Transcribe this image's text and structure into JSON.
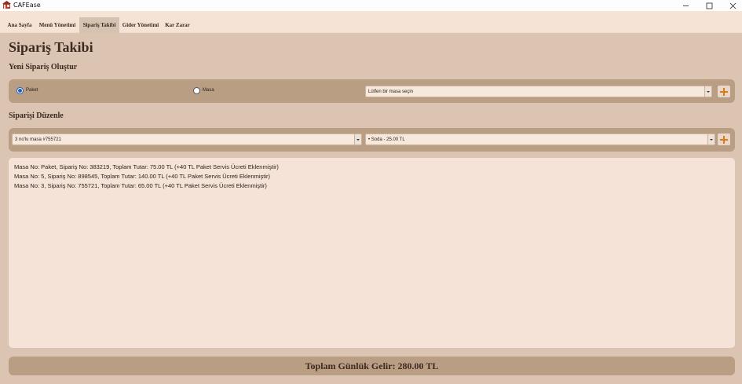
{
  "window": {
    "title": "CAFEase",
    "controls": [
      "minimize-icon",
      "maximize-icon",
      "close-icon"
    ]
  },
  "nav": {
    "tabs": [
      {
        "label": "Ana Sayfa",
        "active": false
      },
      {
        "label": "Menü Yönetimi",
        "active": false
      },
      {
        "label": "Sipariş Takibi",
        "active": true
      },
      {
        "label": "Gider Yönetimi",
        "active": false
      },
      {
        "label": "Kar Zarar",
        "active": false
      }
    ]
  },
  "page": {
    "title": "Sipariş Takibi",
    "new_order": {
      "section_title": "Yeni Sipariş Oluştur",
      "radio_paket": "Paket",
      "radio_masa": "Masa",
      "selected": "Paket",
      "table_select_value": "Lütfen bir masa seçin",
      "add_icon": "plus-icon"
    },
    "edit_order": {
      "section_title": "Siparişi Düzenle",
      "order_select_value": "3 no'lu masa #755721",
      "product_select_value": "• Soda - 25.00 TL",
      "add_icon": "plus-icon"
    },
    "orders": [
      "Masa No: Paket, Sipariş No: 383219, Toplam Tutar: 75.00 TL (+40 TL Paket Servis Ücreti Eklenmiştir)",
      "Masa No: 5, Sipariş No: 898545, Toplam Tutar: 140.00 TL (+40 TL Paket Servis Ücreti Eklenmiştir)",
      "Masa No: 3, Sipariş No: 755721, Toplam Tutar: 65.00 TL (+40 TL Paket Servis Ücreti Eklenmiştir)"
    ],
    "total_label": "Toplam Günlük Gelir: 280.00 TL"
  },
  "colors": {
    "background": "#f5e3d5",
    "panel": "#dbc5b2",
    "bar": "#b99e83",
    "accent_orange": "#d97a17",
    "text_dark": "#3d2a21",
    "radio_blue": "#1f5fb8"
  }
}
